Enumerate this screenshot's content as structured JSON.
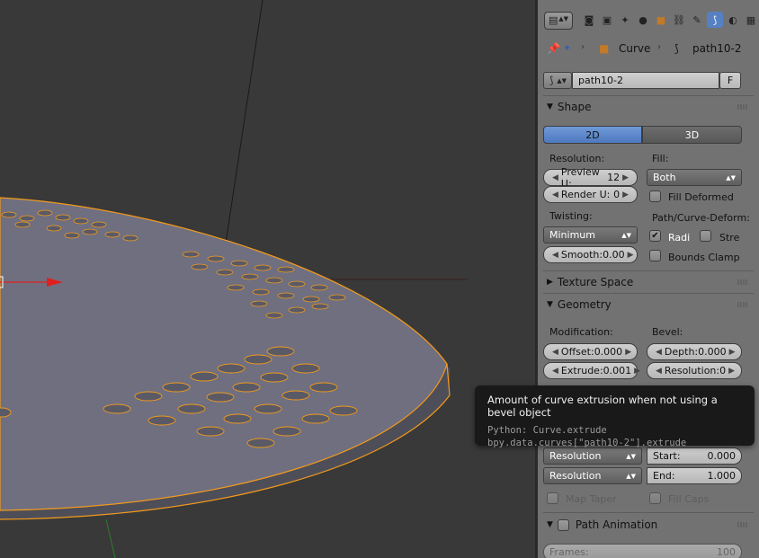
{
  "viewport": {},
  "context_tabs": [
    "render-icon",
    "scene-icon",
    "world-icon",
    "object-icon",
    "constraints-icon",
    "modifiers-icon",
    "curve-data-icon",
    "material-icon",
    "texture-icon"
  ],
  "breadcrumb": {
    "item1": "Curve",
    "item2": "path10-2"
  },
  "datablock": {
    "name": "path10-2",
    "fake_user": "F"
  },
  "shape": {
    "title": "Shape",
    "tab_2d": "2D",
    "tab_3d": "3D",
    "resolution_label": "Resolution:",
    "preview_u_label": "Preview U:",
    "preview_u_value": "12",
    "render_u_label": "Render U:",
    "render_u_value": "0",
    "fill_label": "Fill:",
    "fill_value": "Both",
    "fill_deformed": "Fill Deformed",
    "twisting_label": "Twisting:",
    "twisting_value": "Minimum",
    "smooth_label": "Smooth:",
    "smooth_value": "0.00",
    "path_deform_label": "Path/Curve-Deform:",
    "radius_label": "Radi",
    "stretch_label": "Stre",
    "bounds_clamp": "Bounds Clamp"
  },
  "texture_space": {
    "title": "Texture Space"
  },
  "geometry": {
    "title": "Geometry",
    "modification_label": "Modification:",
    "bevel_label": "Bevel:",
    "offset_label": "Offset:",
    "offset_value": "0.000",
    "depth_label": "Depth:",
    "depth_value": "0.000",
    "extrude_label": "Extrude:",
    "extrude_value": "0.001",
    "resolution_label": "Resolution:",
    "resolution_value": "0",
    "mapping_start": "Resolution",
    "mapping_end": "Resolution",
    "start_label": "Start:",
    "start_value": "0.000",
    "end_label": "End:",
    "end_value": "1.000",
    "map_taper": "Map Taper",
    "fill_caps": "Fill Caps"
  },
  "path_animation": {
    "title": "Path Animation",
    "frames_label": "Frames:",
    "frames_value": "100"
  },
  "tooltip": {
    "title": "Amount of curve extrusion when not using a bevel object",
    "python": "Python: Curve.extrude",
    "path": "bpy.data.curves[\"path10-2\"].extrude"
  },
  "colors": {
    "accent": "#5680c2",
    "selection": "#f29a1d",
    "panel": "#727272",
    "viewport": "#393939"
  }
}
